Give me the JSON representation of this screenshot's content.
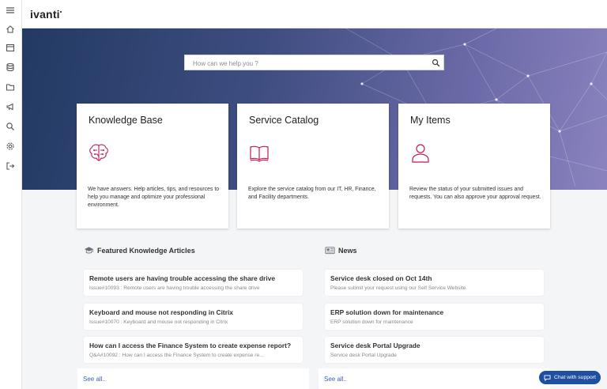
{
  "brand": {
    "logo": "ivanti"
  },
  "sidebar": {
    "items": [
      {
        "name": "menu-icon"
      },
      {
        "name": "home-icon"
      },
      {
        "name": "calendar-icon"
      },
      {
        "name": "database-icon"
      },
      {
        "name": "folder-icon"
      },
      {
        "name": "megaphone-icon"
      },
      {
        "name": "search-icon"
      },
      {
        "name": "settings-icon"
      },
      {
        "name": "logout-icon"
      }
    ]
  },
  "search": {
    "placeholder": "How can we help you ?"
  },
  "cards": [
    {
      "title": "Knowledge Base",
      "description": "We have answers. Help articles, tips, and resources to help you manage and optimize your professional environment.",
      "icon": "brain-icon"
    },
    {
      "title": "Service Catalog",
      "description": "Explore the service catalog from our IT, HR, Finance, and Facility departments.",
      "icon": "book-icon"
    },
    {
      "title": "My Items",
      "description": "Review the status of your submitted issues and requests. You can also approve your approval request.",
      "icon": "user-icon"
    }
  ],
  "knowledge": {
    "heading": "Featured Knowledge Articles",
    "items": [
      {
        "title": "Remote users are having trouble accessing the share drive",
        "sub": "Issue#10093 : Remote users are having trouble accessing the share drive"
      },
      {
        "title": "Keyboard and mouse not responding in Citrix",
        "sub": "Issue#10070 : Keyboard and mouse not responding in Citrix"
      },
      {
        "title": "How can I access the Finance System to create expense report?",
        "sub": "Q&A#10092 : How can I access the Finance System to create expense re..."
      }
    ],
    "see_all": "See all.."
  },
  "news": {
    "heading": "News",
    "items": [
      {
        "title": "Service desk closed on Oct 14th",
        "sub": "Please submit your request using our Self Service Website."
      },
      {
        "title": "ERP solution down for maintenance",
        "sub": "ERP solution down for maintenance"
      },
      {
        "title": "Service desk Portal Upgrade",
        "sub": "Service desk Portal Upgrade"
      }
    ],
    "see_all": "See all.."
  },
  "chat": {
    "label": "Chat with support"
  },
  "colors": {
    "accent": "#c2185b",
    "link": "#3a62b5",
    "chat": "#1e4fa3",
    "hero_start": "#223a63",
    "hero_end": "#8a83bf"
  }
}
